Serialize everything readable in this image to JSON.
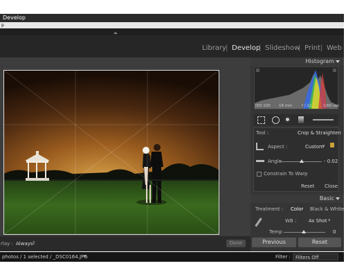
{
  "window": {
    "title": "Develop",
    "menu": "p"
  },
  "modules": [
    "Library",
    "Develop",
    "Slideshow",
    "Print",
    "Web"
  ],
  "active_module": "Develop",
  "histogram": {
    "title": "Histogram",
    "iso": "ISO 100",
    "focal": "18 mm",
    "aperture": "f / 22",
    "shutter": "1/60 sec"
  },
  "tool": {
    "label": "Tool :",
    "name": "Crop & Straighten",
    "aspect_label": "Aspect :",
    "aspect_value": "Custom",
    "angle_label": "Angle",
    "angle_value": "- 0.02",
    "constrain_label": "Constrain To Warp",
    "reset_label": "Reset",
    "close_label": "Close"
  },
  "basic": {
    "title": "Basic",
    "treatment_label": "Treatment :",
    "color_label": "Color",
    "bw_label": "Black & White",
    "wb_label": "WB :",
    "wb_value": "As Shot",
    "temp_label": "Temp",
    "temp_value": "0"
  },
  "bottom": {
    "overlay_label": "rlay :",
    "overlay_value": "Always",
    "done_label": "Done",
    "previous_label": "Previous",
    "reset_label": "Reset"
  },
  "filmstrip": {
    "info": "photos / 1 selected / _DSC0164.JPG",
    "filter_label": "Filter :",
    "filter_value": "Filters Off"
  }
}
